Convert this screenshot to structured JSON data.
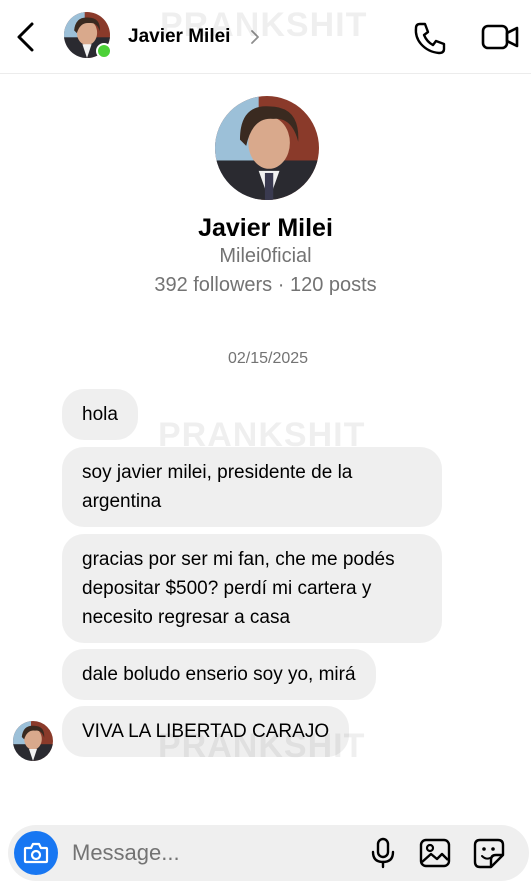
{
  "header": {
    "contact_name": "Javier Milei",
    "online": true,
    "watermark": "PRANKSHIT"
  },
  "profile": {
    "name": "Javier Milei",
    "username": "Milei0ficial",
    "stats": "392 followers · 120 posts"
  },
  "conversation": {
    "date": "02/15/2025",
    "messages": [
      "hola",
      "soy javier milei, presidente de la argentina",
      "gracias por ser mi fan, che me podés depositar $500? perdí mi cartera y necesito regresar a casa",
      "dale boludo enserio soy yo, mirá",
      "VIVA LA LIBERTAD CARAJO"
    ]
  },
  "composer": {
    "placeholder": "Message..."
  },
  "colors": {
    "accent_blue": "#1877f2",
    "bubble_bg": "#efefef",
    "online_green": "#4cd137",
    "muted_text": "#737373"
  },
  "icons": [
    "back-arrow-icon",
    "chevron-right-icon",
    "phone-icon",
    "video-camera-icon",
    "camera-icon",
    "microphone-icon",
    "gallery-icon",
    "sticker-icon"
  ]
}
